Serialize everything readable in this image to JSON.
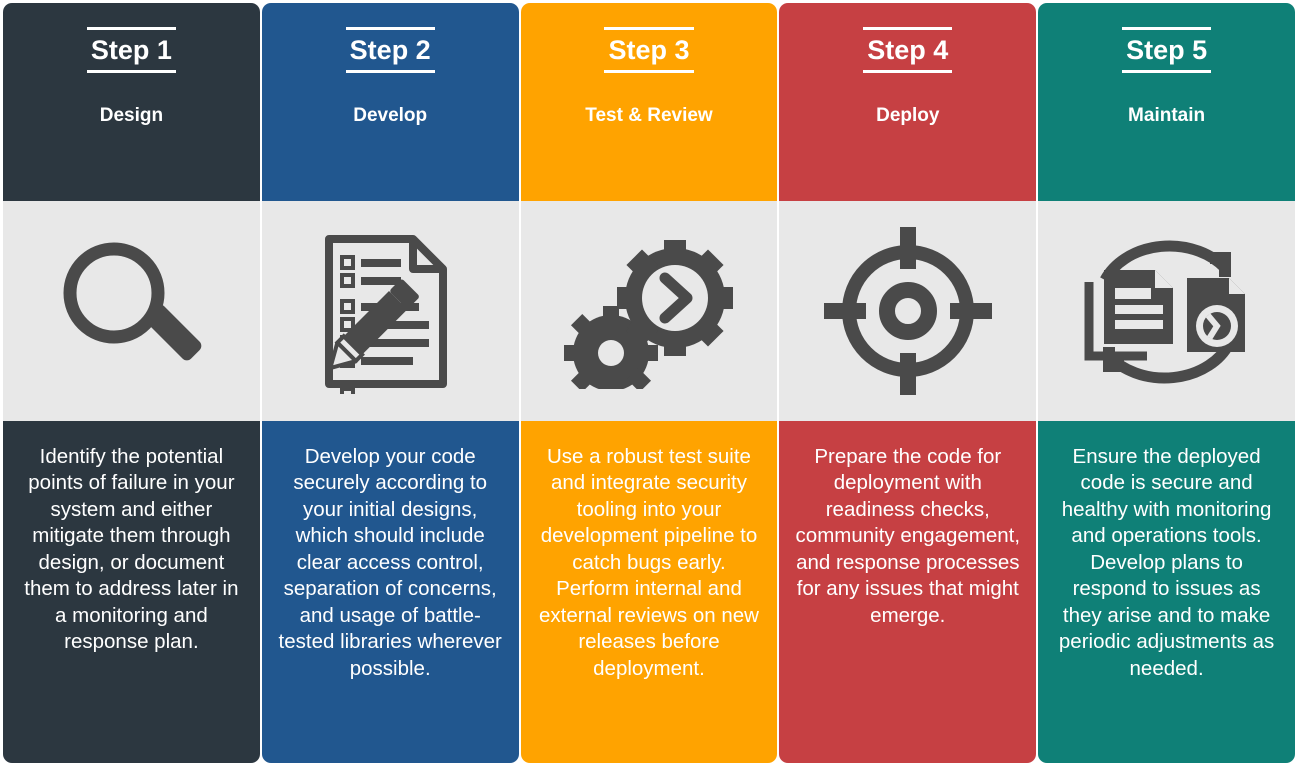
{
  "diagram": {
    "type": "secure-sdlc-process-steps",
    "background": "#ffffff",
    "icon_band_color": "#e8e8e8",
    "icon_glyph_color": "#4a4a4a"
  },
  "steps": [
    {
      "step_label": "Step 1",
      "phase": "Design",
      "color": "#2c3740",
      "icon": "magnifying-glass-icon",
      "body": "Identify the potential points of failure in your system and either mitigate them through design, or document them to address later in a monitoring and response plan."
    },
    {
      "step_label": "Step 2",
      "phase": "Develop",
      "color": "#21578f",
      "icon": "document-checklist-pencil-icon",
      "body": "Develop your code securely according to your initial designs, which should include clear access control, separation of concerns, and usage of battle-tested libraries wherever possible."
    },
    {
      "step_label": "Step 3",
      "phase": "Test & Review",
      "color": "#ffa300",
      "icon": "gears-chevron-icon",
      "body": "Use a robust test suite and integrate security tooling into your development pipeline to catch bugs early. Perform internal and external reviews on new releases before deployment."
    },
    {
      "step_label": "Step 4",
      "phase": "Deploy",
      "color": "#c64043",
      "icon": "crosshair-target-icon",
      "body": "Prepare the code for deployment with readiness checks, community engagement, and response processes for any issues that might emerge."
    },
    {
      "step_label": "Step 5",
      "phase": "Maintain",
      "color": "#0f8077",
      "icon": "documents-sync-arrows-icon",
      "body": "Ensure the deployed code is secure and healthy with monitoring and operations tools. Develop plans to respond to issues as they arise and to make periodic adjustments as needed."
    }
  ]
}
